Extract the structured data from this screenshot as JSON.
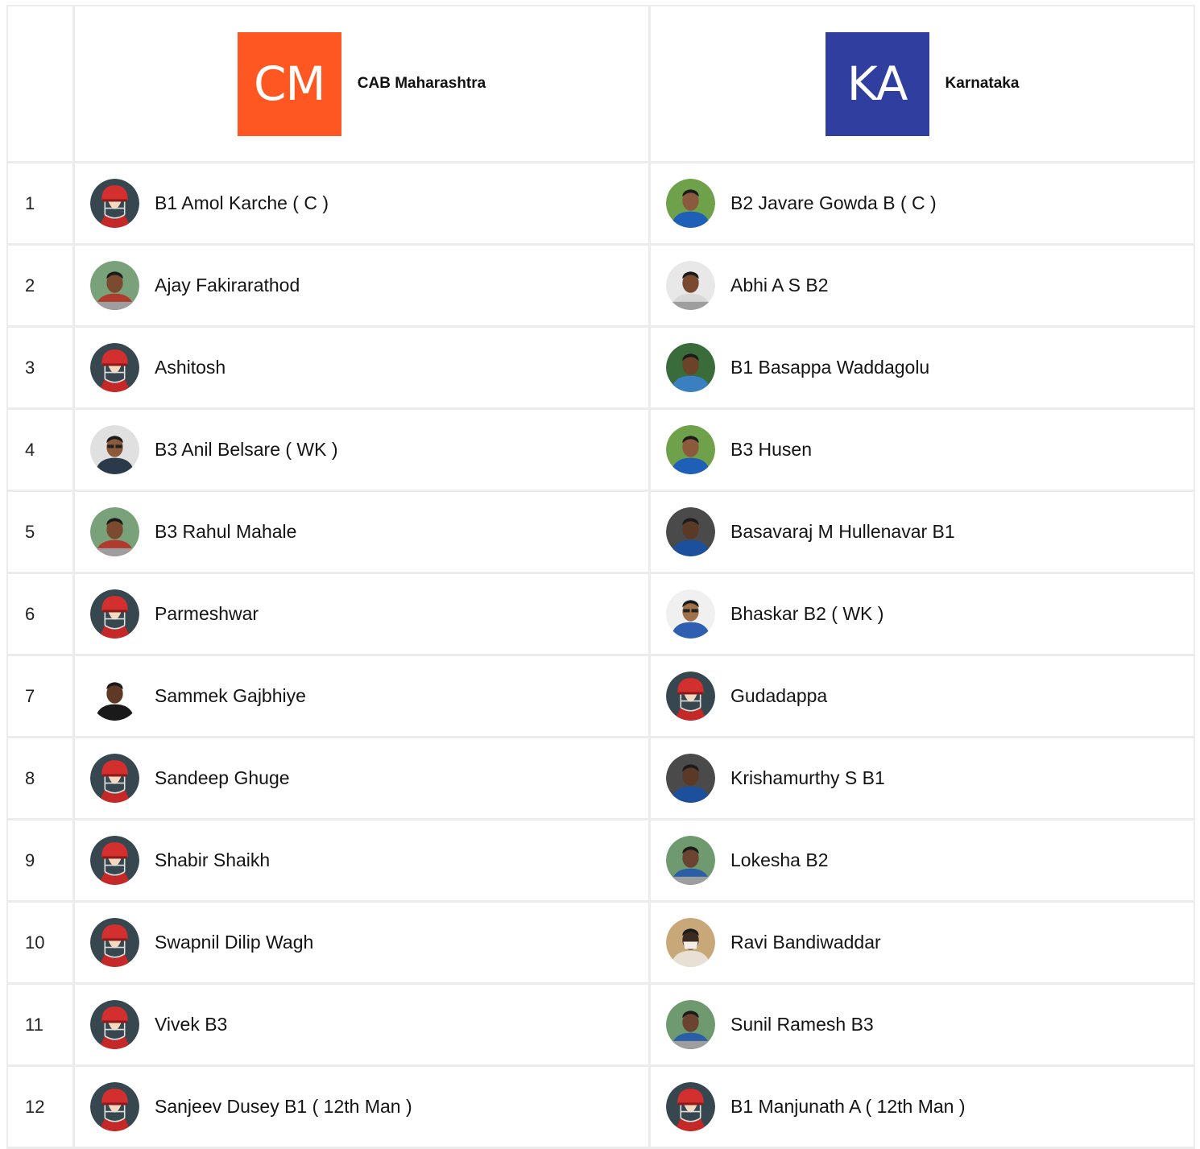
{
  "colors": {
    "cm_logo": "#ff5722",
    "ka_logo": "#303f9f",
    "grid_line": "#ececec"
  },
  "teams": [
    {
      "abbr": "CM",
      "name": "CAB Maharashtra",
      "logo_color": "#ff5722"
    },
    {
      "abbr": "KA",
      "name": "Karnataka",
      "logo_color": "#303f9f"
    }
  ],
  "rows": [
    {
      "num": "1",
      "left": {
        "name": "B1 Amol Karche ( C )",
        "avatar": "helmet-icon"
      },
      "right": {
        "name": "B2 Javare Gowda B ( C )",
        "avatar": "photo-blue"
      }
    },
    {
      "num": "2",
      "left": {
        "name": "Ajay Fakirarathod",
        "avatar": "photo-outdoor"
      },
      "right": {
        "name": "Abhi A S B2",
        "avatar": "photo-face"
      }
    },
    {
      "num": "3",
      "left": {
        "name": "Ashitosh",
        "avatar": "helmet-icon"
      },
      "right": {
        "name": "B1 Basappa Waddagolu",
        "avatar": "photo-group"
      }
    },
    {
      "num": "4",
      "left": {
        "name": "B3 Anil Belsare ( WK )",
        "avatar": "photo-glasses"
      },
      "right": {
        "name": "B3 Husen",
        "avatar": "photo-blue"
      }
    },
    {
      "num": "5",
      "left": {
        "name": "B3 Rahul Mahale",
        "avatar": "photo-outdoor"
      },
      "right": {
        "name": "Basavaraj M Hullenavar B1",
        "avatar": "photo-dark-blue"
      }
    },
    {
      "num": "6",
      "left": {
        "name": "Parmeshwar",
        "avatar": "helmet-icon"
      },
      "right": {
        "name": "Bhaskar B2 ( WK )",
        "avatar": "photo-glasses-blue"
      }
    },
    {
      "num": "7",
      "left": {
        "name": "Sammek Gajbhiye",
        "avatar": "photo-face-dark"
      },
      "right": {
        "name": "Gudadappa",
        "avatar": "helmet-icon"
      }
    },
    {
      "num": "8",
      "left": {
        "name": "Sandeep Ghuge",
        "avatar": "helmet-icon"
      },
      "right": {
        "name": "Krishamurthy S B1",
        "avatar": "photo-dark-blue"
      }
    },
    {
      "num": "9",
      "left": {
        "name": "Shabir Shaikh",
        "avatar": "helmet-icon"
      },
      "right": {
        "name": "Lokesha B2",
        "avatar": "photo-outdoor-blue"
      }
    },
    {
      "num": "10",
      "left": {
        "name": "Swapnil Dilip Wagh",
        "avatar": "helmet-icon"
      },
      "right": {
        "name": "Ravi Bandiwaddar",
        "avatar": "photo-mask"
      }
    },
    {
      "num": "11",
      "left": {
        "name": "Vivek B3",
        "avatar": "helmet-icon"
      },
      "right": {
        "name": "Sunil Ramesh B3",
        "avatar": "photo-outdoor-blue"
      }
    },
    {
      "num": "12",
      "left": {
        "name": "Sanjeev Dusey B1 ( 12th Man )",
        "avatar": "helmet-icon"
      },
      "right": {
        "name": "B1 Manjunath A ( 12th Man )",
        "avatar": "helmet-icon"
      }
    }
  ]
}
